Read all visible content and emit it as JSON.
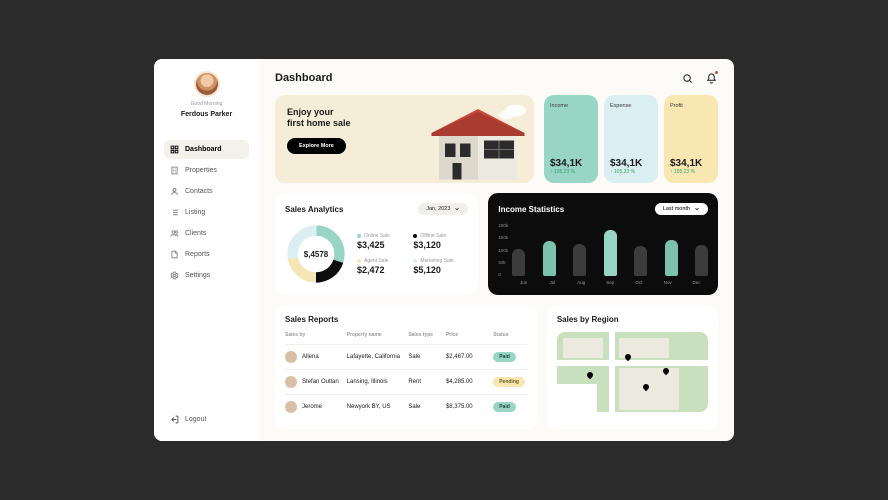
{
  "sidebar": {
    "greeting": "Good Morning",
    "username": "Ferdous Parker",
    "items": [
      {
        "label": "Dashboard",
        "icon": "grid-icon",
        "active": true
      },
      {
        "label": "Properties",
        "icon": "building-icon",
        "active": false
      },
      {
        "label": "Contacts",
        "icon": "user-icon",
        "active": false
      },
      {
        "label": "Listing",
        "icon": "list-icon",
        "active": false
      },
      {
        "label": "Clients",
        "icon": "users-icon",
        "active": false
      },
      {
        "label": "Reports",
        "icon": "document-icon",
        "active": false
      },
      {
        "label": "Settings",
        "icon": "gear-icon",
        "active": false
      }
    ],
    "logout": "Logout"
  },
  "header": {
    "title": "Dashboard"
  },
  "hero": {
    "line1": "Enjoy your",
    "line2": "first home sale",
    "cta": "Explore More"
  },
  "stats": {
    "income": {
      "label": "Income",
      "value": "$34,1K",
      "delta": "↑ 105,23 %"
    },
    "expense": {
      "label": "Expense",
      "value": "$34,1K",
      "delta": "↑ 105,23 %"
    },
    "profit": {
      "label": "Profit",
      "value": "$34,1K",
      "delta": "↑ 105,23 %"
    }
  },
  "analytics": {
    "title": "Sales Analytics",
    "period": "Jan, 2023",
    "center": "$,4578",
    "metrics": [
      {
        "label": "Online Sale",
        "value": "$3,425",
        "color": "#98d5c4"
      },
      {
        "label": "Offline Sale",
        "value": "$3,120",
        "color": "#0c0c0c"
      },
      {
        "label": "Agent Sale",
        "value": "$2,472",
        "color": "#f5e6b8"
      },
      {
        "label": "Marketing Sale",
        "value": "$5,120",
        "color": "#dbeef2"
      }
    ]
  },
  "income_chart": {
    "title": "Income Statistics",
    "period": "Last month"
  },
  "chart_data": {
    "type": "bar",
    "title": "Income Statistics",
    "ylabel": "",
    "ylim": [
      0,
      200
    ],
    "yticks": [
      "200k",
      "150k",
      "100k",
      "50k",
      "0"
    ],
    "categories": [
      "Jun",
      "Jul",
      "Aug",
      "Sep",
      "Oct",
      "Nov",
      "Dec"
    ],
    "values": [
      100,
      130,
      120,
      170,
      110,
      135,
      115
    ],
    "highlight_index": 3
  },
  "reports": {
    "title": "Sales Reports",
    "columns": [
      "Sales by",
      "Property name",
      "Sales type",
      "Price",
      "Status"
    ],
    "rows": [
      {
        "seller": "Allena",
        "property": "Lafayette, California",
        "type": "Sale",
        "price": "$2,467.00",
        "status": "Paid",
        "badge": "paid"
      },
      {
        "seller": "Stefan Outlan",
        "property": "Lansing, Illinois",
        "type": "Rent",
        "price": "$4,285.00",
        "status": "Pending",
        "badge": "pending"
      },
      {
        "seller": "Jerome",
        "property": "Newyork BY, US",
        "type": "Sale",
        "price": "$8,375.00",
        "status": "Paid",
        "badge": "paid"
      }
    ]
  },
  "region": {
    "title": "Sales by Region"
  }
}
